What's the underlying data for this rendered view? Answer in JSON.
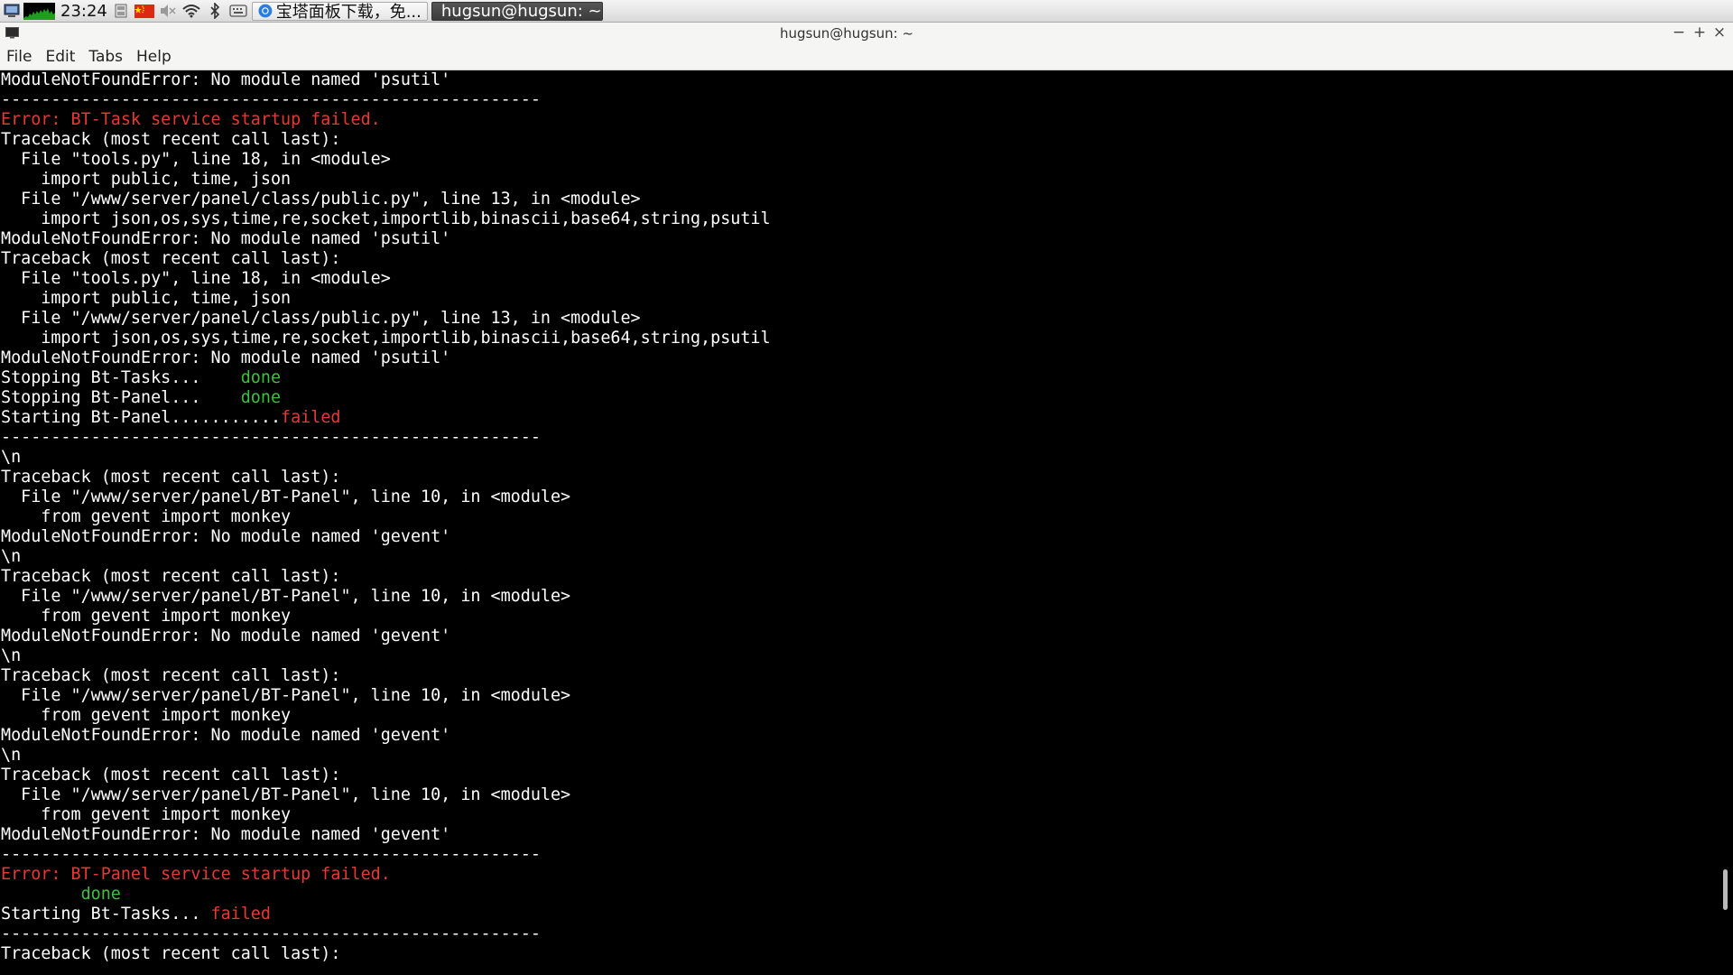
{
  "panel": {
    "clock": "23:24",
    "tasks": [
      {
        "label": "宝塔面板下载，免...",
        "icon": "chrome-icon"
      },
      {
        "label": "hugsun@hugsun: ~",
        "icon": "terminal-icon"
      }
    ],
    "tray_icons": [
      "keyboard-icon",
      "flag-cn-icon",
      "volume-muted-icon",
      "wifi-icon",
      "bluetooth-icon",
      "keyboard-layout-icon"
    ]
  },
  "window": {
    "title": "hugsun@hugsun: ~",
    "controls": {
      "minimize": "−",
      "maximize": "+",
      "close": "×"
    }
  },
  "menubar": {
    "file": "File",
    "edit": "Edit",
    "tabs": "Tabs",
    "help": "Help"
  },
  "colors": {
    "terminal_bg": "#000000",
    "text": "#ffffff",
    "error": "#e53935",
    "ok": "#3fbf3f"
  },
  "terminal": {
    "lines": [
      [
        {
          "t": "ModuleNotFoundError: No module named 'psutil'",
          "c": "n"
        }
      ],
      [
        {
          "t": "------------------------------------------------------",
          "c": "n"
        }
      ],
      [
        {
          "t": "Error: BT-Task service startup failed.",
          "c": "r"
        }
      ],
      [
        {
          "t": "Traceback (most recent call last):",
          "c": "n"
        }
      ],
      [
        {
          "t": "  File \"tools.py\", line 18, in <module>",
          "c": "n"
        }
      ],
      [
        {
          "t": "    import public, time, json",
          "c": "n"
        }
      ],
      [
        {
          "t": "  File \"/www/server/panel/class/public.py\", line 13, in <module>",
          "c": "n"
        }
      ],
      [
        {
          "t": "    import json,os,sys,time,re,socket,importlib,binascii,base64,string,psutil",
          "c": "n"
        }
      ],
      [
        {
          "t": "ModuleNotFoundError: No module named 'psutil'",
          "c": "n"
        }
      ],
      [
        {
          "t": "Traceback (most recent call last):",
          "c": "n"
        }
      ],
      [
        {
          "t": "  File \"tools.py\", line 18, in <module>",
          "c": "n"
        }
      ],
      [
        {
          "t": "    import public, time, json",
          "c": "n"
        }
      ],
      [
        {
          "t": "  File \"/www/server/panel/class/public.py\", line 13, in <module>",
          "c": "n"
        }
      ],
      [
        {
          "t": "    import json,os,sys,time,re,socket,importlib,binascii,base64,string,psutil",
          "c": "n"
        }
      ],
      [
        {
          "t": "ModuleNotFoundError: No module named 'psutil'",
          "c": "n"
        }
      ],
      [
        {
          "t": "Stopping Bt-Tasks...    ",
          "c": "n"
        },
        {
          "t": "done",
          "c": "g"
        }
      ],
      [
        {
          "t": "Stopping Bt-Panel...    ",
          "c": "n"
        },
        {
          "t": "done",
          "c": "g"
        }
      ],
      [
        {
          "t": "Starting Bt-Panel...........",
          "c": "n"
        },
        {
          "t": "failed",
          "c": "r"
        }
      ],
      [
        {
          "t": "------------------------------------------------------",
          "c": "n"
        }
      ],
      [
        {
          "t": "\\n",
          "c": "n"
        }
      ],
      [
        {
          "t": "Traceback (most recent call last):",
          "c": "n"
        }
      ],
      [
        {
          "t": "  File \"/www/server/panel/BT-Panel\", line 10, in <module>",
          "c": "n"
        }
      ],
      [
        {
          "t": "    from gevent import monkey",
          "c": "n"
        }
      ],
      [
        {
          "t": "ModuleNotFoundError: No module named 'gevent'",
          "c": "n"
        }
      ],
      [
        {
          "t": "\\n",
          "c": "n"
        }
      ],
      [
        {
          "t": "Traceback (most recent call last):",
          "c": "n"
        }
      ],
      [
        {
          "t": "  File \"/www/server/panel/BT-Panel\", line 10, in <module>",
          "c": "n"
        }
      ],
      [
        {
          "t": "    from gevent import monkey",
          "c": "n"
        }
      ],
      [
        {
          "t": "ModuleNotFoundError: No module named 'gevent'",
          "c": "n"
        }
      ],
      [
        {
          "t": "\\n",
          "c": "n"
        }
      ],
      [
        {
          "t": "Traceback (most recent call last):",
          "c": "n"
        }
      ],
      [
        {
          "t": "  File \"/www/server/panel/BT-Panel\", line 10, in <module>",
          "c": "n"
        }
      ],
      [
        {
          "t": "    from gevent import monkey",
          "c": "n"
        }
      ],
      [
        {
          "t": "ModuleNotFoundError: No module named 'gevent'",
          "c": "n"
        }
      ],
      [
        {
          "t": "\\n",
          "c": "n"
        }
      ],
      [
        {
          "t": "Traceback (most recent call last):",
          "c": "n"
        }
      ],
      [
        {
          "t": "  File \"/www/server/panel/BT-Panel\", line 10, in <module>",
          "c": "n"
        }
      ],
      [
        {
          "t": "    from gevent import monkey",
          "c": "n"
        }
      ],
      [
        {
          "t": "ModuleNotFoundError: No module named 'gevent'",
          "c": "n"
        }
      ],
      [
        {
          "t": "------------------------------------------------------",
          "c": "n"
        }
      ],
      [
        {
          "t": "Error: BT-Panel service startup failed.",
          "c": "r"
        }
      ],
      [
        {
          "t": "        ",
          "c": "n"
        },
        {
          "t": "done",
          "c": "g"
        }
      ],
      [
        {
          "t": "Starting Bt-Tasks... ",
          "c": "n"
        },
        {
          "t": "failed",
          "c": "r"
        }
      ],
      [
        {
          "t": "------------------------------------------------------",
          "c": "n"
        }
      ],
      [
        {
          "t": "Traceback (most recent call last):",
          "c": "n"
        }
      ]
    ]
  }
}
